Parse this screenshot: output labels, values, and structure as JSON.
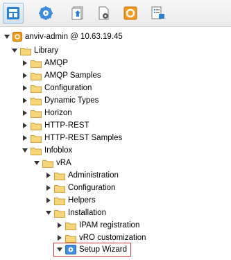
{
  "toolbar": {
    "buttons": [
      {
        "icon": "inventory-icon",
        "active": true
      },
      {
        "icon": "workflow-gear-icon",
        "active": false
      },
      {
        "icon": "action-script-icon",
        "active": false
      },
      {
        "icon": "resource-gear-icon",
        "active": false
      },
      {
        "icon": "configuration-orange-icon",
        "active": false
      },
      {
        "icon": "package-icon",
        "active": false
      }
    ]
  },
  "tree": {
    "root": "anviv-admin @ 10.63.19.45",
    "items": [
      {
        "label": "Library"
      },
      {
        "label": "AMQP"
      },
      {
        "label": "AMQP Samples"
      },
      {
        "label": "Configuration"
      },
      {
        "label": "Dynamic Types"
      },
      {
        "label": "Horizon"
      },
      {
        "label": "HTTP-REST"
      },
      {
        "label": "HTTP-REST Samples"
      },
      {
        "label": "Infoblox"
      },
      {
        "label": "vRA"
      },
      {
        "label": "Administration"
      },
      {
        "label": "Configuration"
      },
      {
        "label": "Helpers"
      },
      {
        "label": "Installation"
      },
      {
        "label": "IPAM registration"
      },
      {
        "label": "vRO customization"
      },
      {
        "label": "Setup Wizard"
      }
    ]
  },
  "colors": {
    "folder_fill": "#f7d57a",
    "folder_edge": "#c9a23a",
    "selection_border": "#d9343a",
    "toolbar_active": "#cfe2f4"
  }
}
